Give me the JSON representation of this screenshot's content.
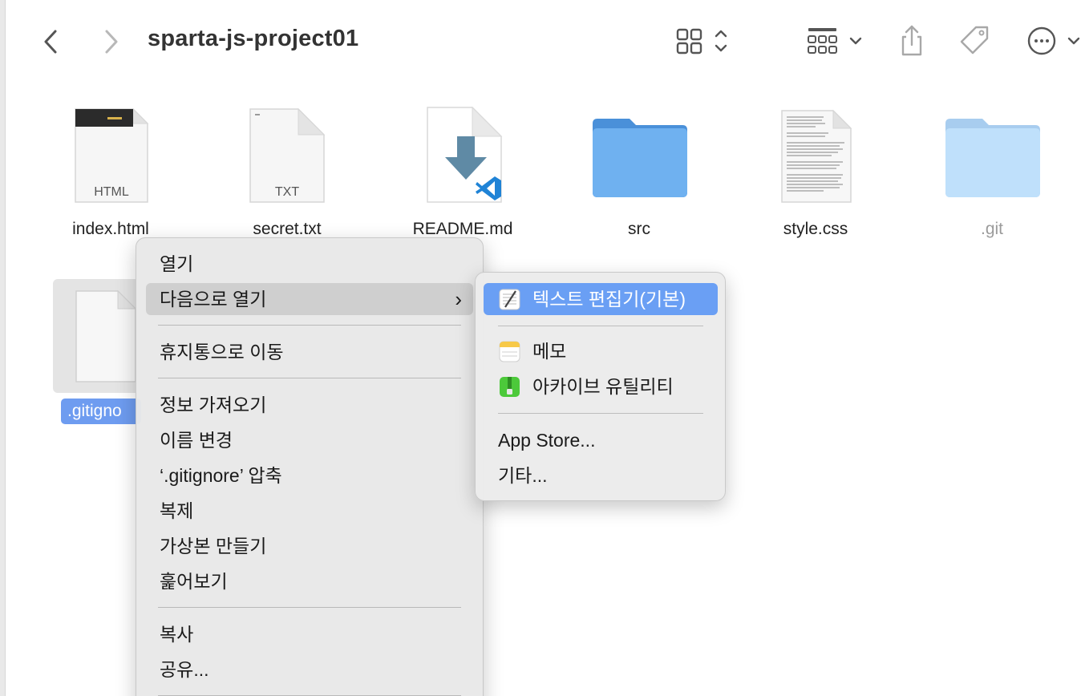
{
  "toolbar": {
    "title": "sparta-js-project01",
    "icons": [
      "chevron-left-icon",
      "chevron-right-icon",
      "icon-view-icon",
      "group-by-icon",
      "share-icon",
      "tag-icon",
      "more-icon"
    ]
  },
  "files": [
    {
      "name": "index.html",
      "badge": "HTML",
      "icon": "html-document-icon"
    },
    {
      "name": "secret.txt",
      "badge": "TXT",
      "icon": "text-document-icon"
    },
    {
      "name": "README.md",
      "icon": "markdown-vscode-icon"
    },
    {
      "name": "src",
      "icon": "folder-icon"
    },
    {
      "name": "style.css",
      "icon": "css-document-icon"
    },
    {
      "name": ".git",
      "icon": "hidden-folder-icon"
    },
    {
      "name": ".gitignore",
      "visible_name": ".gitigno",
      "icon": "blank-document-icon",
      "selected": true
    }
  ],
  "context_menu": {
    "items": [
      {
        "label": "열기"
      },
      {
        "label": "다음으로 열기",
        "submenu": true
      },
      {
        "label": "휴지통으로 이동"
      },
      {
        "label": "정보 가져오기"
      },
      {
        "label": "이름 변경"
      },
      {
        "label": "‘.gitignore’ 압축"
      },
      {
        "label": "복제"
      },
      {
        "label": "가상본 만들기"
      },
      {
        "label": "훑어보기"
      },
      {
        "label": "복사"
      },
      {
        "label": "공유..."
      }
    ]
  },
  "submenu": {
    "items": [
      {
        "label": "텍스트 편집기(기본)",
        "icon": "textedit-icon"
      },
      {
        "label": "메모",
        "icon": "notes-icon"
      },
      {
        "label": "아카이브 유틸리티",
        "icon": "archive-utility-icon"
      },
      {
        "label": "App Store..."
      },
      {
        "label": "기타..."
      }
    ]
  }
}
